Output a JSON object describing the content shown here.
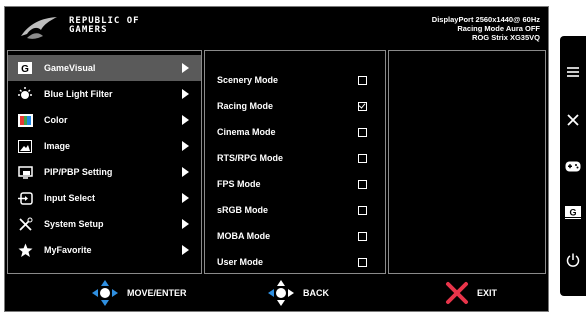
{
  "header": {
    "brand_line1": "REPUBLIC OF",
    "brand_line2": "GAMERS",
    "status": [
      "DisplayPort 2560x1440@ 60Hz",
      "Racing Mode Aura OFF",
      "ROG Strix XG35VQ"
    ]
  },
  "menu": [
    {
      "label": "GameVisual",
      "icon": "gamevisual-icon",
      "active": true
    },
    {
      "label": "Blue Light Filter",
      "icon": "blue-light-icon",
      "active": false
    },
    {
      "label": "Color",
      "icon": "color-icon",
      "active": false
    },
    {
      "label": "Image",
      "icon": "image-icon",
      "active": false
    },
    {
      "label": "PIP/PBP Setting",
      "icon": "pip-icon",
      "active": false
    },
    {
      "label": "Input Select",
      "icon": "input-select-icon",
      "active": false
    },
    {
      "label": "System Setup",
      "icon": "system-setup-icon",
      "active": false
    },
    {
      "label": "MyFavorite",
      "icon": "star-icon",
      "active": false
    }
  ],
  "submenu": [
    {
      "label": "Scenery Mode",
      "checked": false
    },
    {
      "label": "Racing Mode",
      "checked": true
    },
    {
      "label": "Cinema Mode",
      "checked": false
    },
    {
      "label": "RTS/RPG Mode",
      "checked": false
    },
    {
      "label": "FPS Mode",
      "checked": false
    },
    {
      "label": "sRGB Mode",
      "checked": false
    },
    {
      "label": "MOBA Mode",
      "checked": false
    },
    {
      "label": "User Mode",
      "checked": false
    }
  ],
  "footer": {
    "move_label": "MOVE/ENTER",
    "back_label": "BACK",
    "exit_label": "EXIT"
  },
  "sidebar_icon": "gamevisual-small-icon",
  "sidebar_icon_text": "G",
  "colors": {
    "background": "#000000",
    "active_row": "#5a5a5a",
    "nav_blue": "#2f8fe0",
    "exit_red": "#e8344a"
  }
}
